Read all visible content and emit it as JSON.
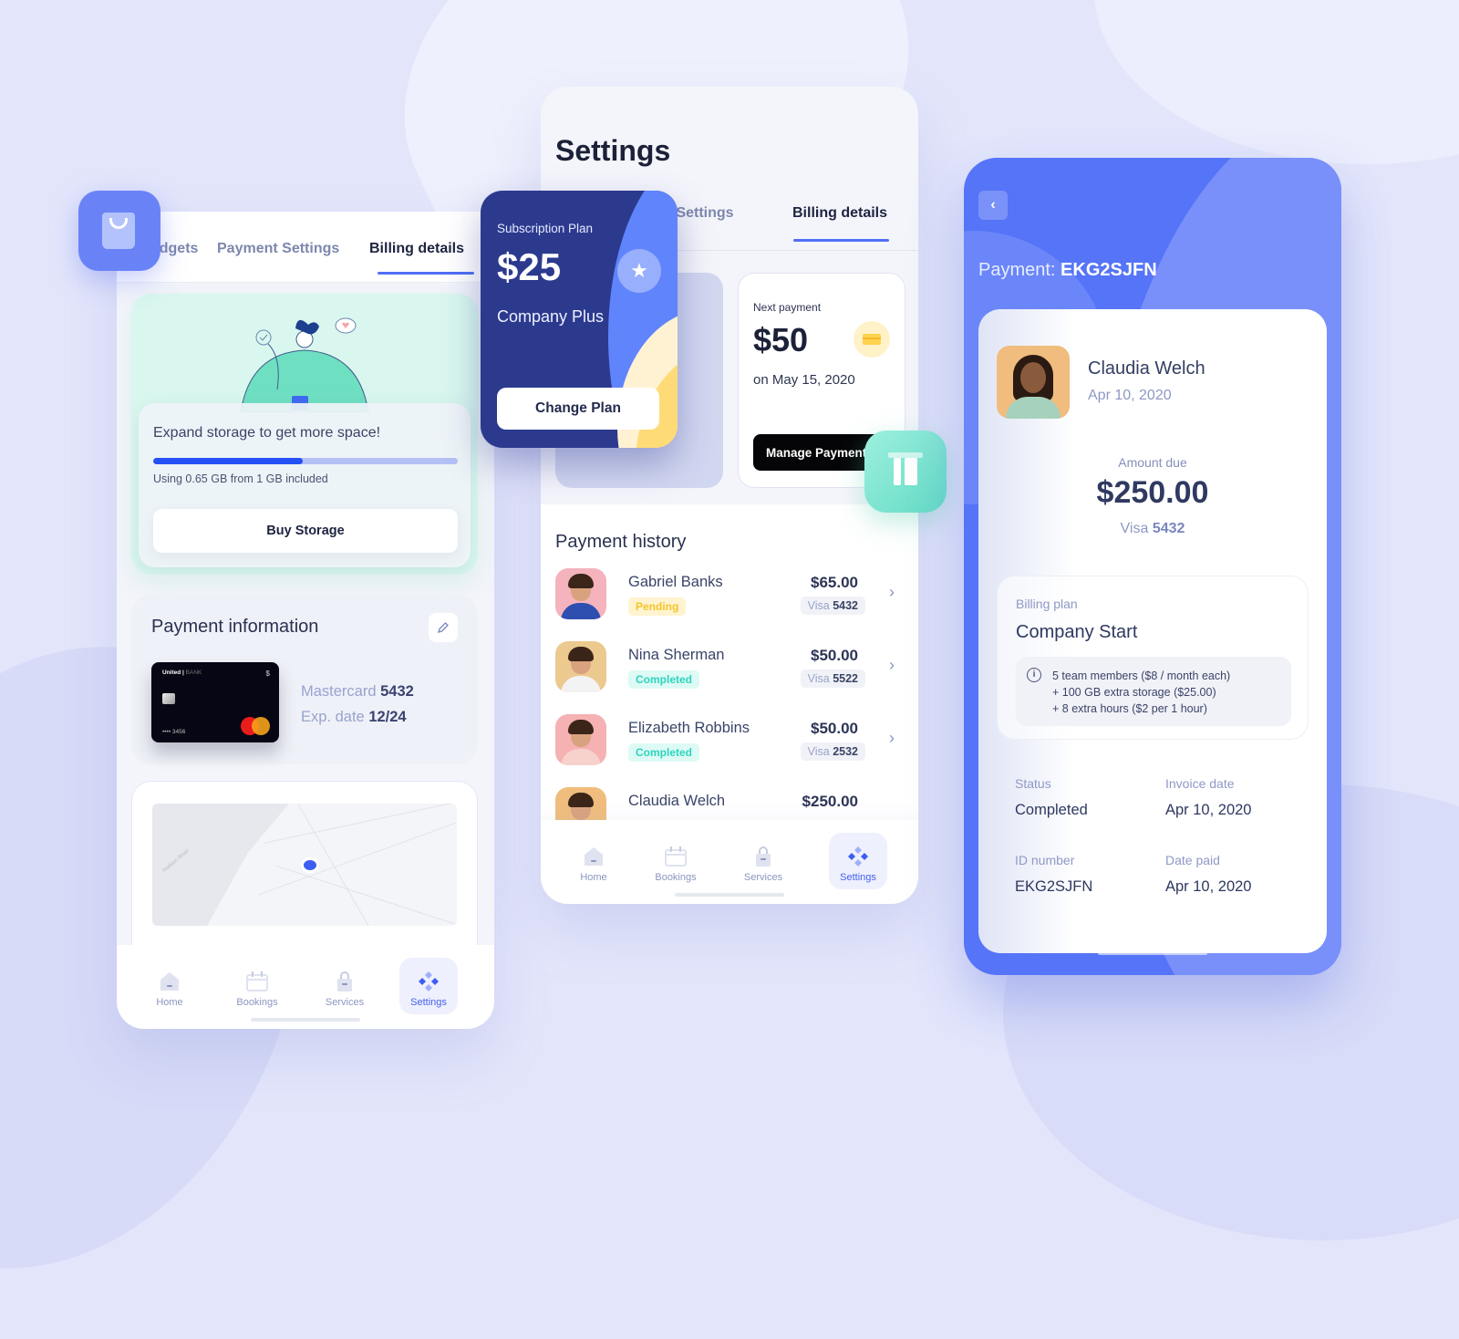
{
  "colors": {
    "accent": "#4f6ff5",
    "primary_dark": "#2c3a8e",
    "pending": "#f5c32c",
    "completed": "#2ed4be",
    "teal": "#63dbc4"
  },
  "phone_left": {
    "tabs": [
      {
        "label": "e Widgets",
        "active": false
      },
      {
        "label": "Payment Settings",
        "active": false
      },
      {
        "label": "Billing details",
        "active": true
      }
    ],
    "storage_promo": {
      "title": "Expand storage to get more space!",
      "used_gb": 0.65,
      "total_gb": 1,
      "usage_text": "Using 0.65 GB from 1 GB included",
      "button_label": "Buy Storage"
    },
    "payment_info": {
      "title": "Payment information",
      "edit_icon": "pencil-icon",
      "card": {
        "bank": "United",
        "bank_suffix": "BANK",
        "currency": "$",
        "number_masked": "•••• 3456"
      },
      "card_type_label": "Mastercard",
      "card_last4": "5432",
      "exp_label": "Exp. date",
      "exp_value": "12/24"
    },
    "map": {
      "label": "Hudson River"
    },
    "nav": [
      {
        "label": "Home",
        "icon": "home-icon",
        "active": false
      },
      {
        "label": "Bookings",
        "icon": "calendar-icon",
        "active": false
      },
      {
        "label": "Services",
        "icon": "bag-icon",
        "active": false
      },
      {
        "label": "Settings",
        "icon": "settings-diamond-icon",
        "active": true
      }
    ]
  },
  "phone_middle": {
    "title": "Settings",
    "tabs": [
      {
        "label": "ent Settings",
        "active": false
      },
      {
        "label": "Billing details",
        "active": true
      }
    ],
    "subscription": {
      "label": "Subscription Plan",
      "price": "$25",
      "plan": "Company Plus",
      "button_label": "Change Plan",
      "icon": "star-icon"
    },
    "next_payment": {
      "label": "Next payment",
      "amount": "$50",
      "date": "on May 15, 2020",
      "button_label": "Manage Payment",
      "icon": "credit-card-icon"
    },
    "history": {
      "title": "Payment history",
      "rows": [
        {
          "name": "Gabriel Banks",
          "status": "Pending",
          "amount": "$65.00",
          "card": "Visa",
          "last4": "5432",
          "bg": "#f4b3bd",
          "body": "#2f4fb0"
        },
        {
          "name": "Nina Sherman",
          "status": "Completed",
          "amount": "$50.00",
          "card": "Visa",
          "last4": "5522",
          "bg": "#ecc98f",
          "body": "#f3f3f3"
        },
        {
          "name": "Elizabeth Robbins",
          "status": "Completed",
          "amount": "$50.00",
          "card": "Visa",
          "last4": "2532",
          "bg": "#f6b1b3",
          "body": "#f7d2cc"
        },
        {
          "name": "Claudia Welch",
          "status": "",
          "amount": "$250.00",
          "card": "",
          "last4": "",
          "bg": "#f0bd7e",
          "body": "#a6d1bc"
        }
      ]
    },
    "nav": [
      {
        "label": "Home",
        "icon": "home-icon",
        "active": false
      },
      {
        "label": "Bookings",
        "icon": "calendar-icon",
        "active": false
      },
      {
        "label": "Services",
        "icon": "bag-icon",
        "active": false
      },
      {
        "label": "Settings",
        "icon": "settings-diamond-icon",
        "active": true
      }
    ]
  },
  "phone_right": {
    "title_prefix": "Payment:",
    "payment_id": "EKG2SJFN",
    "customer": {
      "name": "Claudia Welch",
      "date": "Apr 10, 2020"
    },
    "amount_label": "Amount due",
    "amount": "$250.00",
    "card": "Visa",
    "card_last4": "5432",
    "billing_plan": {
      "label": "Billing plan",
      "name": "Company Start",
      "lines": [
        "5 team members ($8 / month each)",
        "+ 100 GB extra storage ($25.00)",
        "+ 8 extra hours ($2 per 1 hour)"
      ]
    },
    "fields": [
      {
        "label": "Status",
        "value": "Completed"
      },
      {
        "label": "Invoice date",
        "value": "Apr 10, 2020"
      },
      {
        "label": "ID number",
        "value": "EKG2SJFN"
      },
      {
        "label": "Date paid",
        "value": "Apr 10, 2020"
      }
    ]
  }
}
